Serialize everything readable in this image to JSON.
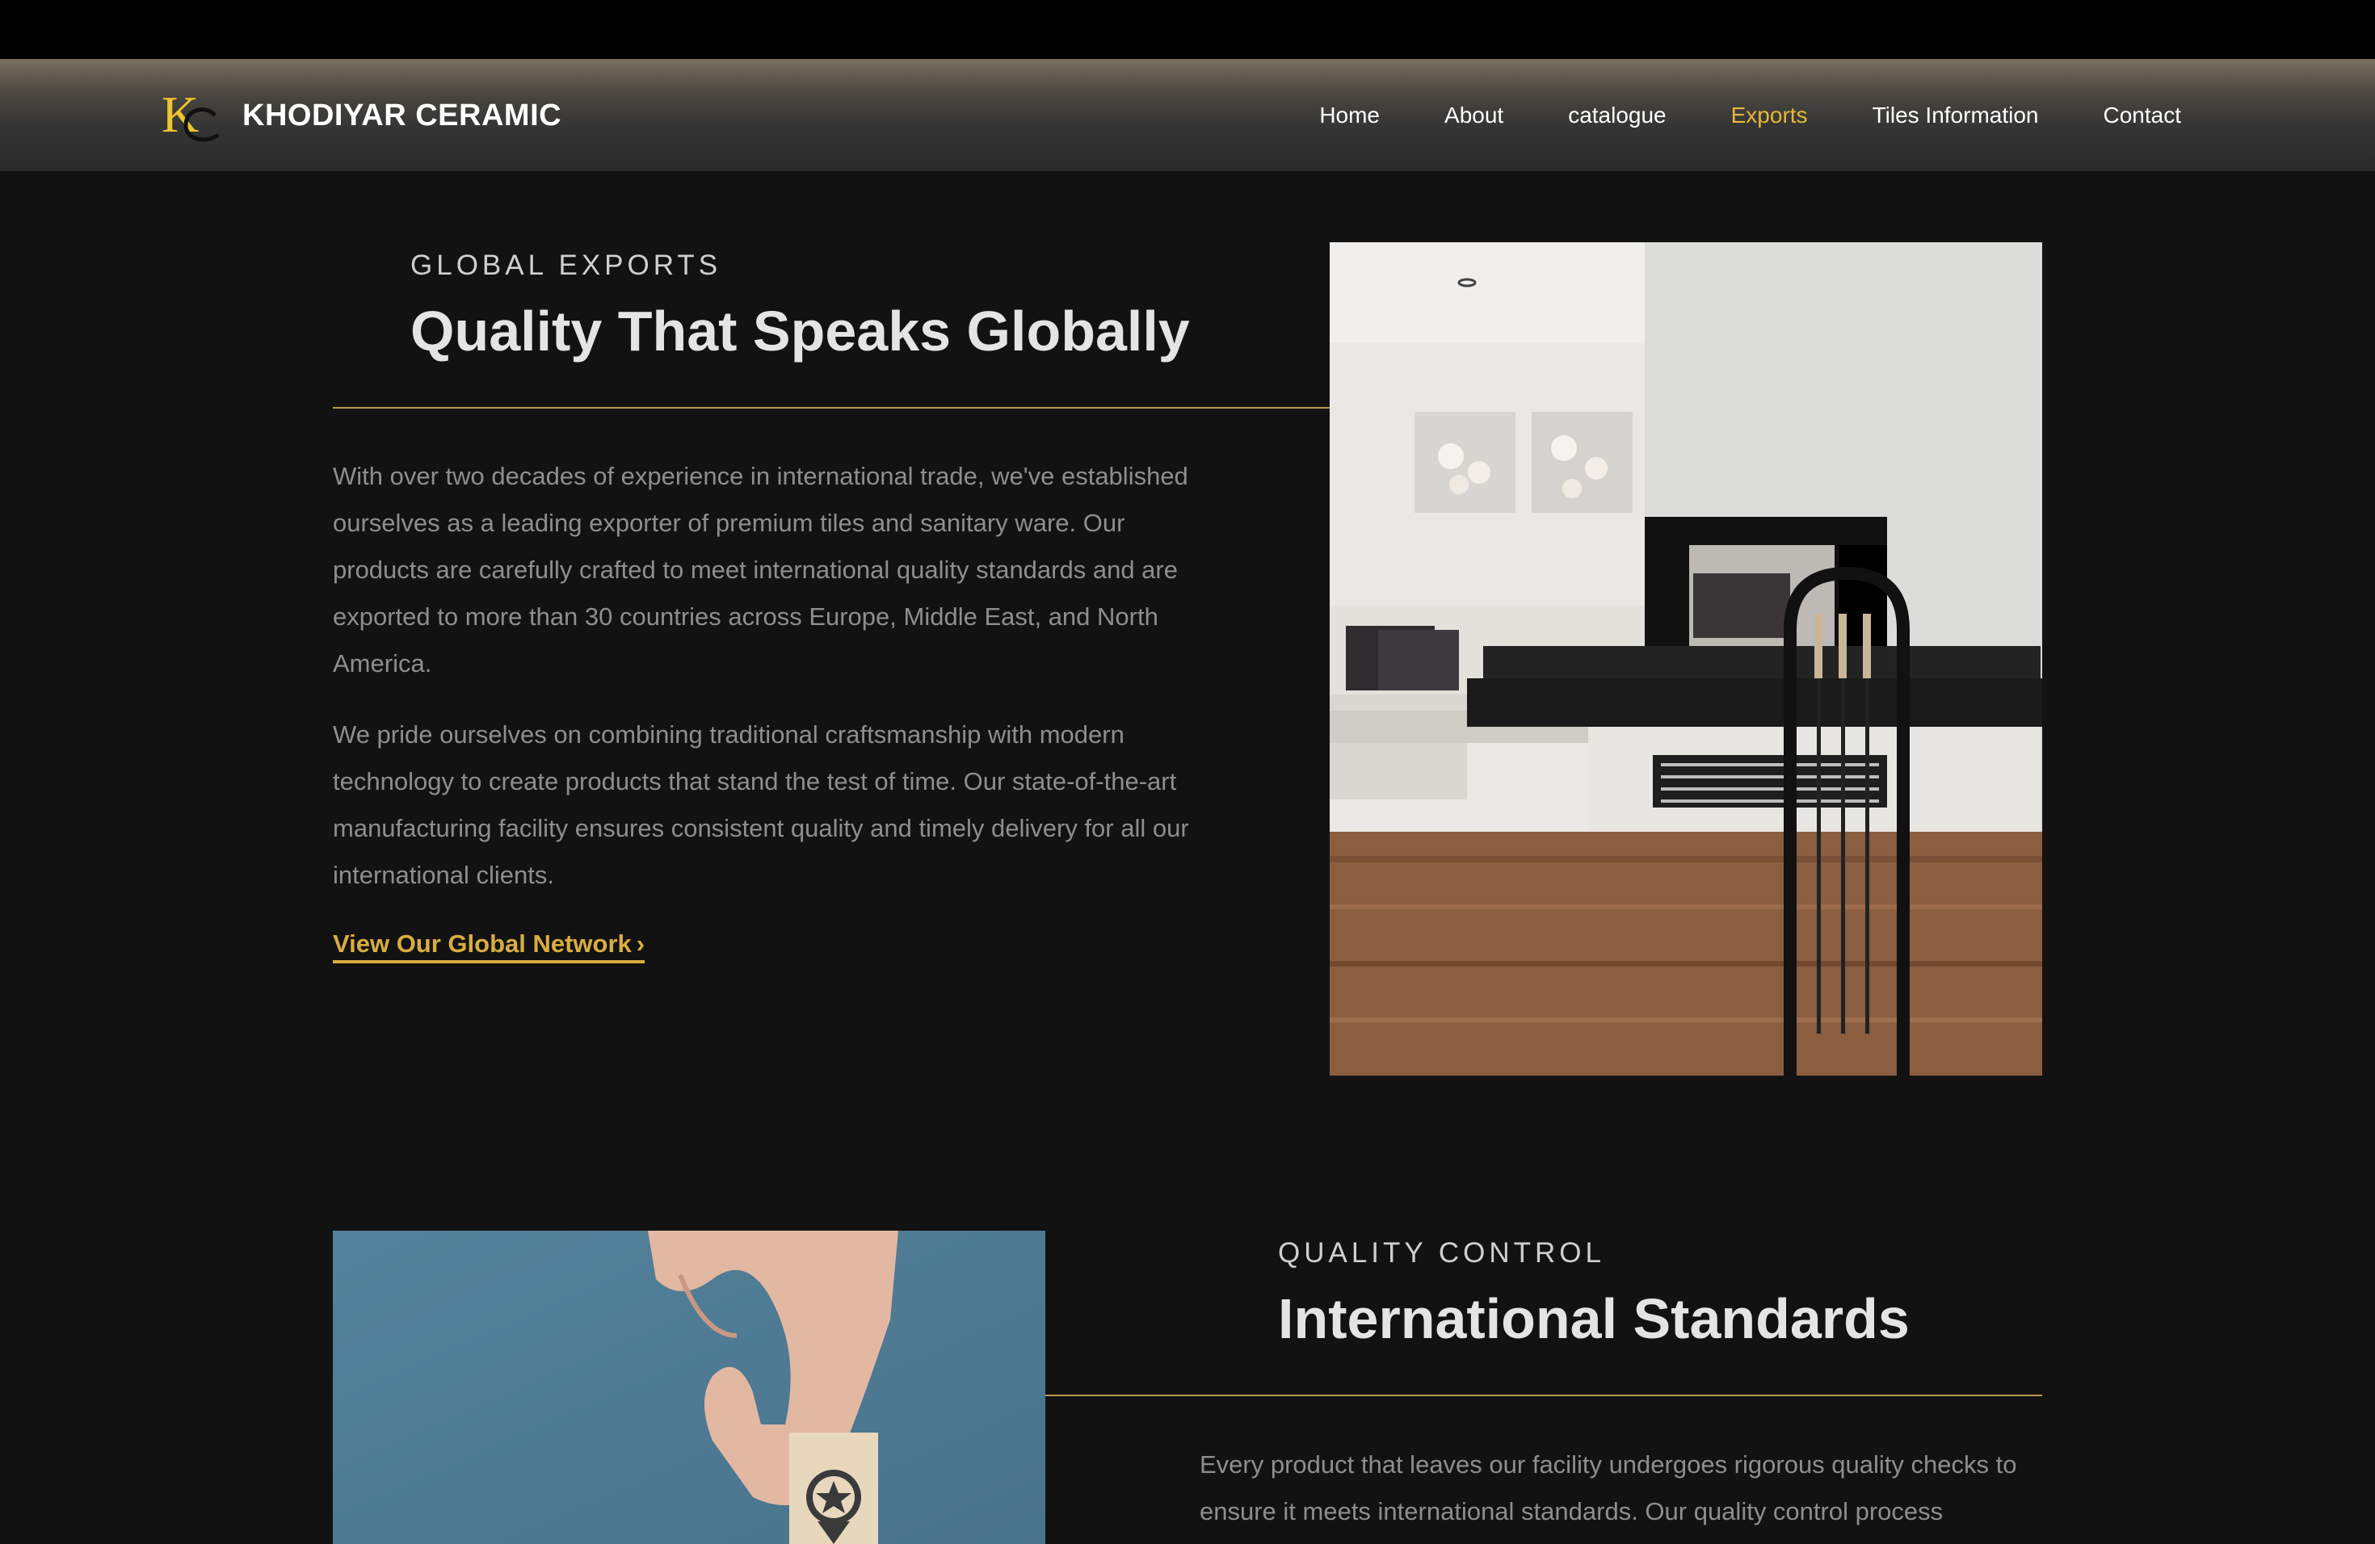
{
  "brand": {
    "name": "KHODIYAR CERAMIC",
    "logo_letters": "KC"
  },
  "nav": {
    "items": [
      {
        "label": "Home"
      },
      {
        "label": "About"
      },
      {
        "label": "catalogue"
      },
      {
        "label": "Exports"
      },
      {
        "label": "Tiles Information"
      },
      {
        "label": "Contact"
      }
    ],
    "active": "Exports"
  },
  "exports_section": {
    "eyebrow": "GLOBAL EXPORTS",
    "title": "Quality That Speaks Globally",
    "paragraph_1": "With over two decades of experience in international trade, we've established ourselves as a leading exporter of premium tiles and sanitary ware. Our products are carefully crafted to meet international quality standards and are exported to more than 30 countries across Europe, Middle East, and North America.",
    "paragraph_2": "We pride ourselves on combining traditional craftsmanship with modern technology to create products that stand the test of time. Our state-of-the-art manufacturing facility ensures consistent quality and timely delivery for all our international clients.",
    "cta_label": "View Our Global Network",
    "cta_icon": "chevron-right-icon",
    "image": "living-room-fireplace-photo"
  },
  "quality_section": {
    "eyebrow": "QUALITY CONTROL",
    "title": "International Standards",
    "paragraph_1": "Every product that leaves our facility undergoes rigorous quality checks to ensure it meets international standards. Our quality control process",
    "image": "hand-holding-award-block-photo"
  },
  "colors": {
    "accent": "#e6b73a",
    "background": "#121212",
    "rule": "#b79a4d"
  }
}
